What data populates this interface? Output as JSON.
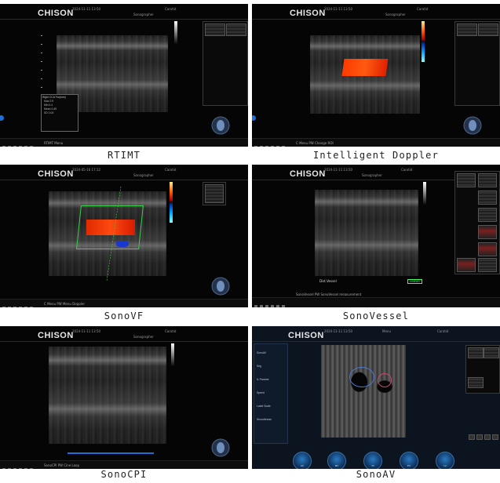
{
  "brand": "CHISON",
  "tiles": [
    {
      "id": "rtimt",
      "caption": "RTIMT",
      "header_left": "2024-11-11 13:50",
      "header_mid": "Sonographer",
      "header_right": "Carotid",
      "bottom_text": "RTIMT Menu",
      "table_title": "Right CCA Far(mm)",
      "table_rows": [
        [
          "Max",
          "0.5"
        ],
        [
          "Min",
          "0.4"
        ],
        [
          "Mean",
          "0.45"
        ],
        [
          "SD",
          "0.04"
        ]
      ]
    },
    {
      "id": "intelligent-doppler",
      "caption": "Intelligent Doppler",
      "header_left": "2024-11-11 13:50",
      "header_mid": "Sonographer",
      "header_right": "Carotid",
      "bottom_text": "C Menu   PW Change ROI"
    },
    {
      "id": "sonovf",
      "caption": "SonoVF",
      "header_left": "2024-05-16 17:12",
      "header_mid": "Sonographer",
      "header_right": "Carotid",
      "bottom_text": "C Menu   PW Menu Doppler"
    },
    {
      "id": "sonovessel",
      "caption": "SonoVessel",
      "header_left": "2024-11-11 13:50",
      "header_mid": "Sonographer",
      "header_right": "Carotid",
      "bottom_text": "SonoVessel   PW SonoVessel measurement",
      "overlay_text": "Dist.Vessel",
      "overlay_badge": "LINEAR"
    },
    {
      "id": "sonocpi",
      "caption": "SonoCPI",
      "header_left": "2024-11-11 13:50",
      "header_mid": "Sonographer",
      "header_right": "Carotid",
      "bottom_text": "SonoCPI   PW Cine Loop"
    },
    {
      "id": "sonoav",
      "caption": "SonoAV",
      "header_left": "2024-11-11 13:50",
      "header_mid": "Menu",
      "header_right": "Carotid",
      "menu_labels": [
        "SonoAV",
        "Seg",
        "IL Parame",
        "Speed",
        "Label Scale",
        "Smoothness"
      ],
      "buttons": [
        "AV",
        "MV",
        "TV",
        "PV",
        "LV"
      ]
    }
  ]
}
